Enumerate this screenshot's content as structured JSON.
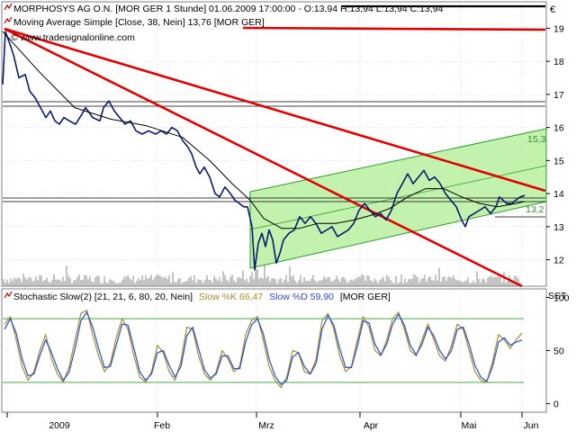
{
  "header": {
    "price_title": "MORPHOSYS AG O.N. [MOR GER  1 Stunde] 01.06.2009 17:00:00 - O:13,94 H:13,94 L:13,94 C:13,94",
    "ma_title": "Moving Average Simple [Close, 38, Nein] 13,76 [MOR GER]",
    "watermark": "© www.tradesignalonline.com",
    "currency": "€"
  },
  "stoch_header": {
    "prefix": "Stochastic Slow(2) [21, 21, 6, 80, 20, Nein]",
    "k_label": "Slow %K 66,47",
    "d_label": "Slow %D 59,90",
    "suffix": "[MOR GER]",
    "axis_title": "SST"
  },
  "colors": {
    "price_line": "#0a1a6e",
    "ma_line": "#000000",
    "trend_line": "#e00000",
    "channel_fill": "#b8f0a0",
    "channel_border": "#2e9a2e",
    "stoch_k": "#a09030",
    "stoch_d": "#2a4ad8",
    "grid": "#c8c8c8"
  },
  "chart_data": [
    {
      "type": "line",
      "panel": "price",
      "ylim": [
        11.2,
        19.8
      ],
      "y_ticks": [
        12,
        13,
        14,
        15,
        16,
        17,
        18,
        19
      ],
      "x_labels": [
        "2009",
        "Feb",
        "Mrz",
        "Apr",
        "Mai",
        "Jun"
      ],
      "channel_labels": [
        {
          "text": "15,3"
        },
        {
          "text": "13,2"
        }
      ],
      "series": [
        {
          "name": "MORPHOSYS AG O.N.",
          "kind": "price",
          "points": [
            [
              0,
              17.3
            ],
            [
              3,
              18.9
            ],
            [
              7,
              18.6
            ],
            [
              12,
              18.2
            ],
            [
              18,
              17.5
            ],
            [
              25,
              17.6
            ],
            [
              30,
              17.1
            ],
            [
              36,
              16.9
            ],
            [
              42,
              16.6
            ],
            [
              48,
              16.3
            ],
            [
              53,
              16.5
            ],
            [
              58,
              16.2
            ],
            [
              63,
              16.1
            ],
            [
              68,
              16.3
            ],
            [
              74,
              16.2
            ],
            [
              81,
              16.1
            ],
            [
              88,
              16.4
            ],
            [
              92,
              16.6
            ],
            [
              100,
              16.3
            ],
            [
              108,
              16.2
            ],
            [
              112,
              16.6
            ],
            [
              118,
              16.8
            ],
            [
              124,
              16.5
            ],
            [
              130,
              16.3
            ],
            [
              136,
              16.1
            ],
            [
              142,
              16.2
            ],
            [
              148,
              15.9
            ],
            [
              155,
              15.8
            ],
            [
              162,
              15.9
            ],
            [
              170,
              15.8
            ],
            [
              176,
              15.9
            ],
            [
              182,
              15.8
            ],
            [
              188,
              16.0
            ],
            [
              194,
              15.9
            ],
            [
              200,
              15.6
            ],
            [
              206,
              15.4
            ],
            [
              210,
              15.2
            ],
            [
              215,
              14.8
            ],
            [
              219,
              14.6
            ],
            [
              224,
              14.8
            ],
            [
              230,
              14.5
            ],
            [
              236,
              14.0
            ],
            [
              241,
              13.9
            ],
            [
              247,
              14.2
            ],
            [
              253,
              14.0
            ],
            [
              258,
              13.8
            ],
            [
              263,
              13.7
            ],
            [
              268,
              13.6
            ],
            [
              272,
              13.6
            ],
            [
              277,
              13.0
            ],
            [
              280,
              11.7
            ],
            [
              284,
              12.5
            ],
            [
              288,
              12.8
            ],
            [
              292,
              12.4
            ],
            [
              296,
              12.9
            ],
            [
              300,
              12.6
            ],
            [
              304,
              11.9
            ],
            [
              308,
              12.2
            ],
            [
              312,
              12.6
            ],
            [
              318,
              12.8
            ],
            [
              324,
              12.9
            ],
            [
              330,
              13.3
            ],
            [
              336,
              13.1
            ],
            [
              342,
              13.3
            ],
            [
              348,
              13.1
            ],
            [
              354,
              12.8
            ],
            [
              360,
              12.9
            ],
            [
              366,
              13.0
            ],
            [
              372,
              12.7
            ],
            [
              378,
              12.8
            ],
            [
              384,
              12.9
            ],
            [
              390,
              13.1
            ],
            [
              396,
              13.5
            ],
            [
              402,
              13.7
            ],
            [
              408,
              13.5
            ],
            [
              414,
              13.3
            ],
            [
              420,
              13.4
            ],
            [
              426,
              13.2
            ],
            [
              432,
              13.5
            ],
            [
              438,
              14.0
            ],
            [
              444,
              14.3
            ],
            [
              450,
              14.6
            ],
            [
              456,
              14.3
            ],
            [
              462,
              14.5
            ],
            [
              468,
              14.7
            ],
            [
              474,
              14.4
            ],
            [
              480,
              14.5
            ],
            [
              486,
              14.3
            ],
            [
              492,
              14.0
            ],
            [
              498,
              13.8
            ],
            [
              504,
              13.6
            ],
            [
              510,
              13.2
            ],
            [
              514,
              13.0
            ],
            [
              518,
              13.3
            ],
            [
              524,
              13.4
            ],
            [
              530,
              13.5
            ],
            [
              536,
              13.6
            ],
            [
              542,
              13.4
            ],
            [
              548,
              13.6
            ],
            [
              552,
              13.9
            ],
            [
              556,
              13.8
            ],
            [
              560,
              13.7
            ],
            [
              566,
              13.7
            ],
            [
              570,
              13.8
            ],
            [
              575,
              13.9
            ],
            [
              580,
              13.94
            ]
          ]
        },
        {
          "name": "Moving Average Simple",
          "kind": "ma",
          "points": [
            [
              0,
              18.9
            ],
            [
              40,
              17.7
            ],
            [
              80,
              16.6
            ],
            [
              120,
              16.25
            ],
            [
              160,
              16.05
            ],
            [
              200,
              15.7
            ],
            [
              230,
              15.0
            ],
            [
              255,
              14.3
            ],
            [
              275,
              13.8
            ],
            [
              290,
              13.25
            ],
            [
              310,
              12.95
            ],
            [
              330,
              12.95
            ],
            [
              350,
              13.1
            ],
            [
              370,
              13.1
            ],
            [
              390,
              13.2
            ],
            [
              410,
              13.35
            ],
            [
              430,
              13.55
            ],
            [
              450,
              13.9
            ],
            [
              470,
              14.15
            ],
            [
              490,
              14.15
            ],
            [
              510,
              13.9
            ],
            [
              530,
              13.7
            ],
            [
              550,
              13.6
            ],
            [
              570,
              13.7
            ],
            [
              580,
              13.76
            ]
          ]
        }
      ]
    },
    {
      "type": "line",
      "panel": "stochastic",
      "ylim": [
        -8,
        108
      ],
      "y_ticks": [
        0,
        50,
        100
      ],
      "levels": [
        80,
        20
      ],
      "series": [
        {
          "name": "Slow %K",
          "values": [
            75,
            82,
            60,
            35,
            22,
            30,
            50,
            65,
            42,
            28,
            20,
            35,
            60,
            85,
            88,
            65,
            45,
            30,
            38,
            62,
            80,
            70,
            45,
            25,
            20,
            30,
            55,
            48,
            30,
            22,
            40,
            72,
            70,
            45,
            28,
            22,
            30,
            50,
            42,
            30,
            35,
            65,
            78,
            82,
            60,
            35,
            22,
            15,
            25,
            50,
            48,
            30,
            28,
            42,
            78,
            85,
            70,
            45,
            30,
            35,
            60,
            82,
            72,
            50,
            45,
            60,
            80,
            86,
            70,
            50,
            45,
            60,
            75,
            60,
            45,
            40,
            55,
            75,
            70,
            50,
            30,
            22,
            20,
            40,
            65,
            60,
            52,
            60,
            66.47
          ]
        },
        {
          "name": "Slow %D",
          "values": [
            70,
            80,
            66,
            42,
            26,
            28,
            45,
            60,
            48,
            33,
            22,
            30,
            52,
            78,
            86,
            72,
            52,
            34,
            35,
            55,
            75,
            74,
            52,
            30,
            22,
            28,
            48,
            50,
            36,
            25,
            35,
            64,
            72,
            52,
            32,
            24,
            28,
            45,
            45,
            33,
            33,
            58,
            74,
            80,
            66,
            42,
            26,
            18,
            22,
            44,
            48,
            35,
            28,
            38,
            70,
            83,
            74,
            52,
            34,
            34,
            54,
            78,
            76,
            56,
            46,
            56,
            75,
            84,
            74,
            55,
            46,
            56,
            72,
            64,
            50,
            42,
            50,
            70,
            72,
            56,
            36,
            25,
            21,
            35,
            58,
            62,
            55,
            58,
            59.9
          ]
        }
      ]
    }
  ]
}
